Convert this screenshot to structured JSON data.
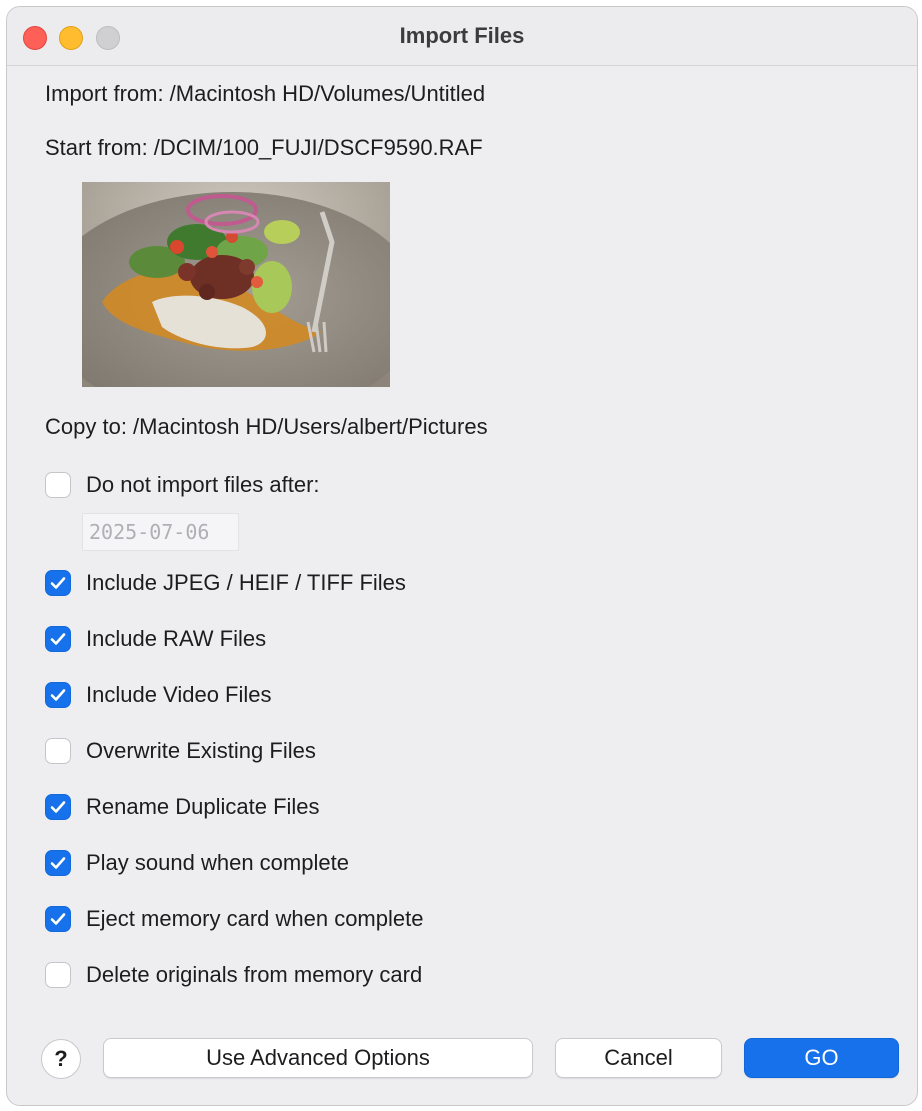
{
  "window": {
    "title": "Import Files"
  },
  "paths": {
    "import_from": "Import from: /Macintosh HD/Volumes/Untitled",
    "start_from": "Start from: /DCIM/100_FUJI/DSCF9590.RAF",
    "copy_to": "Copy to: /Macintosh HD/Users/albert/Pictures"
  },
  "preview": {
    "icon": "photo-thumbnail"
  },
  "date_filter": {
    "label": "Do not import files after:",
    "checked": false,
    "value": "2025-07-06"
  },
  "options": [
    {
      "label": "Include JPEG / HEIF / TIFF Files",
      "checked": true
    },
    {
      "label": "Include RAW Files",
      "checked": true
    },
    {
      "label": "Include Video Files",
      "checked": true
    },
    {
      "label": "Overwrite Existing Files",
      "checked": false
    },
    {
      "label": "Rename Duplicate Files",
      "checked": true
    },
    {
      "label": "Play sound when complete",
      "checked": true
    },
    {
      "label": "Eject memory card when complete",
      "checked": true
    },
    {
      "label": "Delete originals from memory card",
      "checked": false
    }
  ],
  "buttons": {
    "help": "?",
    "advanced": "Use Advanced Options",
    "cancel": "Cancel",
    "go": "GO"
  },
  "colors": {
    "accent": "#1671ea",
    "close": "#fe5f57",
    "minimize": "#febc2e",
    "zoom_inactive": "#d0d0d2"
  }
}
